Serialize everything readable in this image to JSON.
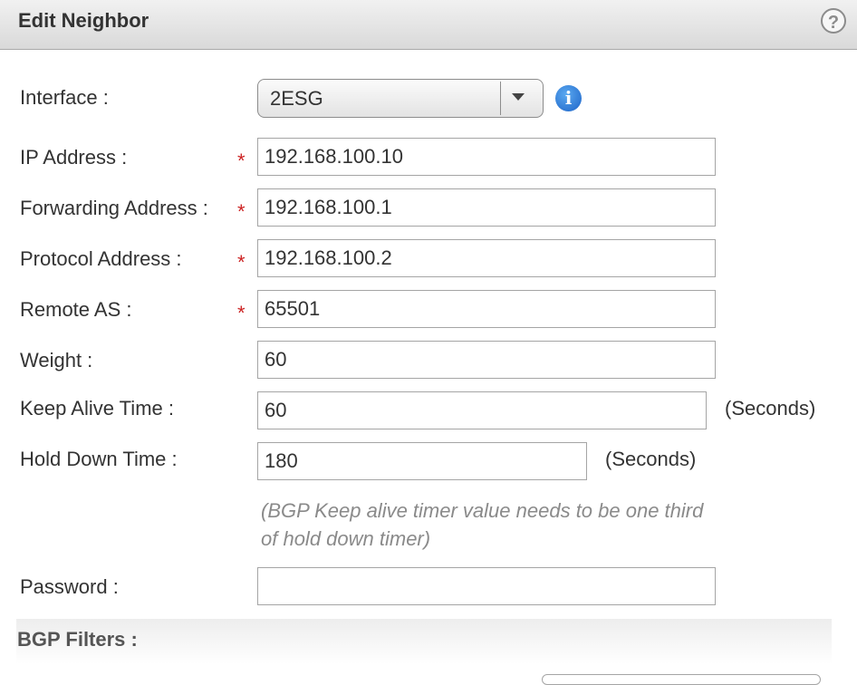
{
  "dialog": {
    "title": "Edit Neighbor"
  },
  "form": {
    "interface": {
      "label": "Interface :",
      "value": "2ESG"
    },
    "ip_address": {
      "label": "IP Address :",
      "value": "192.168.100.10",
      "required_mark": "*"
    },
    "forwarding_address": {
      "label": "Forwarding Address :",
      "value": "192.168.100.1",
      "required_mark": "*"
    },
    "protocol_address": {
      "label": "Protocol Address :",
      "value": "192.168.100.2",
      "required_mark": "*"
    },
    "remote_as": {
      "label": "Remote AS :",
      "value": "65501",
      "required_mark": "*"
    },
    "weight": {
      "label": "Weight :",
      "value": "60"
    },
    "keep_alive_time": {
      "label": "Keep Alive Time :",
      "value": "60",
      "unit": "(Seconds)"
    },
    "hold_down_time": {
      "label": "Hold Down Time :",
      "value": "180",
      "unit": "(Seconds)"
    },
    "hint": "(BGP Keep alive timer value needs to be one third of hold down timer)",
    "password": {
      "label": "Password :",
      "value": ""
    }
  },
  "sections": {
    "bgp_filters": "BGP Filters :"
  },
  "icons": {
    "help": "help-icon",
    "info": "info-icon",
    "dropdown": "chevron-down-icon"
  },
  "colors": {
    "required": "#cc2222",
    "info_blue": "#1d64c8",
    "hint_text": "#8a8a8a"
  }
}
